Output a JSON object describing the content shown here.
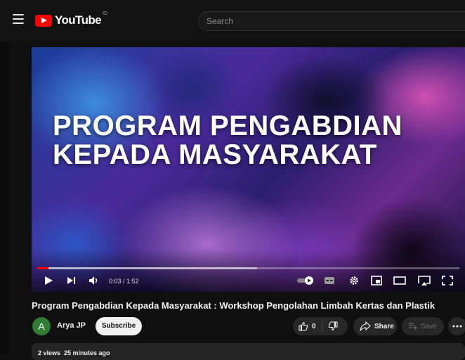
{
  "header": {
    "logo_text": "YouTube",
    "region": "ID",
    "search_placeholder": "Search"
  },
  "player": {
    "title_lines": [
      "PROGRAM PENGABDIAN",
      "KEPADA MASYARAKAT"
    ],
    "time_current": "0:03",
    "time_total": "1:52",
    "time_display": "0:03 / 1:52",
    "progress_fraction": 0.027,
    "buffered_fraction": 0.52,
    "progress_color": "#ff0000"
  },
  "video": {
    "title": "Program Pengabdian Kepada Masyarakat : Workshop Pengolahan Limbah Kertas dan Plastik"
  },
  "channel": {
    "avatar_letter": "A",
    "avatar_color": "#2e7d32",
    "name": "Arya JP",
    "subscribe_label": "Subscribe"
  },
  "actions": {
    "like_count": "0",
    "share_label": "Share",
    "save_label": "Save"
  },
  "description": {
    "meta": "2 views  25 minutes ago"
  },
  "icons": [
    "menu-icon",
    "youtube-logo-icon",
    "play-icon",
    "next-icon",
    "volume-icon",
    "autoplay-toggle-icon",
    "subtitles-icon",
    "settings-icon",
    "miniplayer-icon",
    "theater-icon",
    "cast-icon",
    "fullscreen-icon",
    "like-icon",
    "dislike-icon",
    "share-icon",
    "save-icon",
    "more-icon"
  ]
}
